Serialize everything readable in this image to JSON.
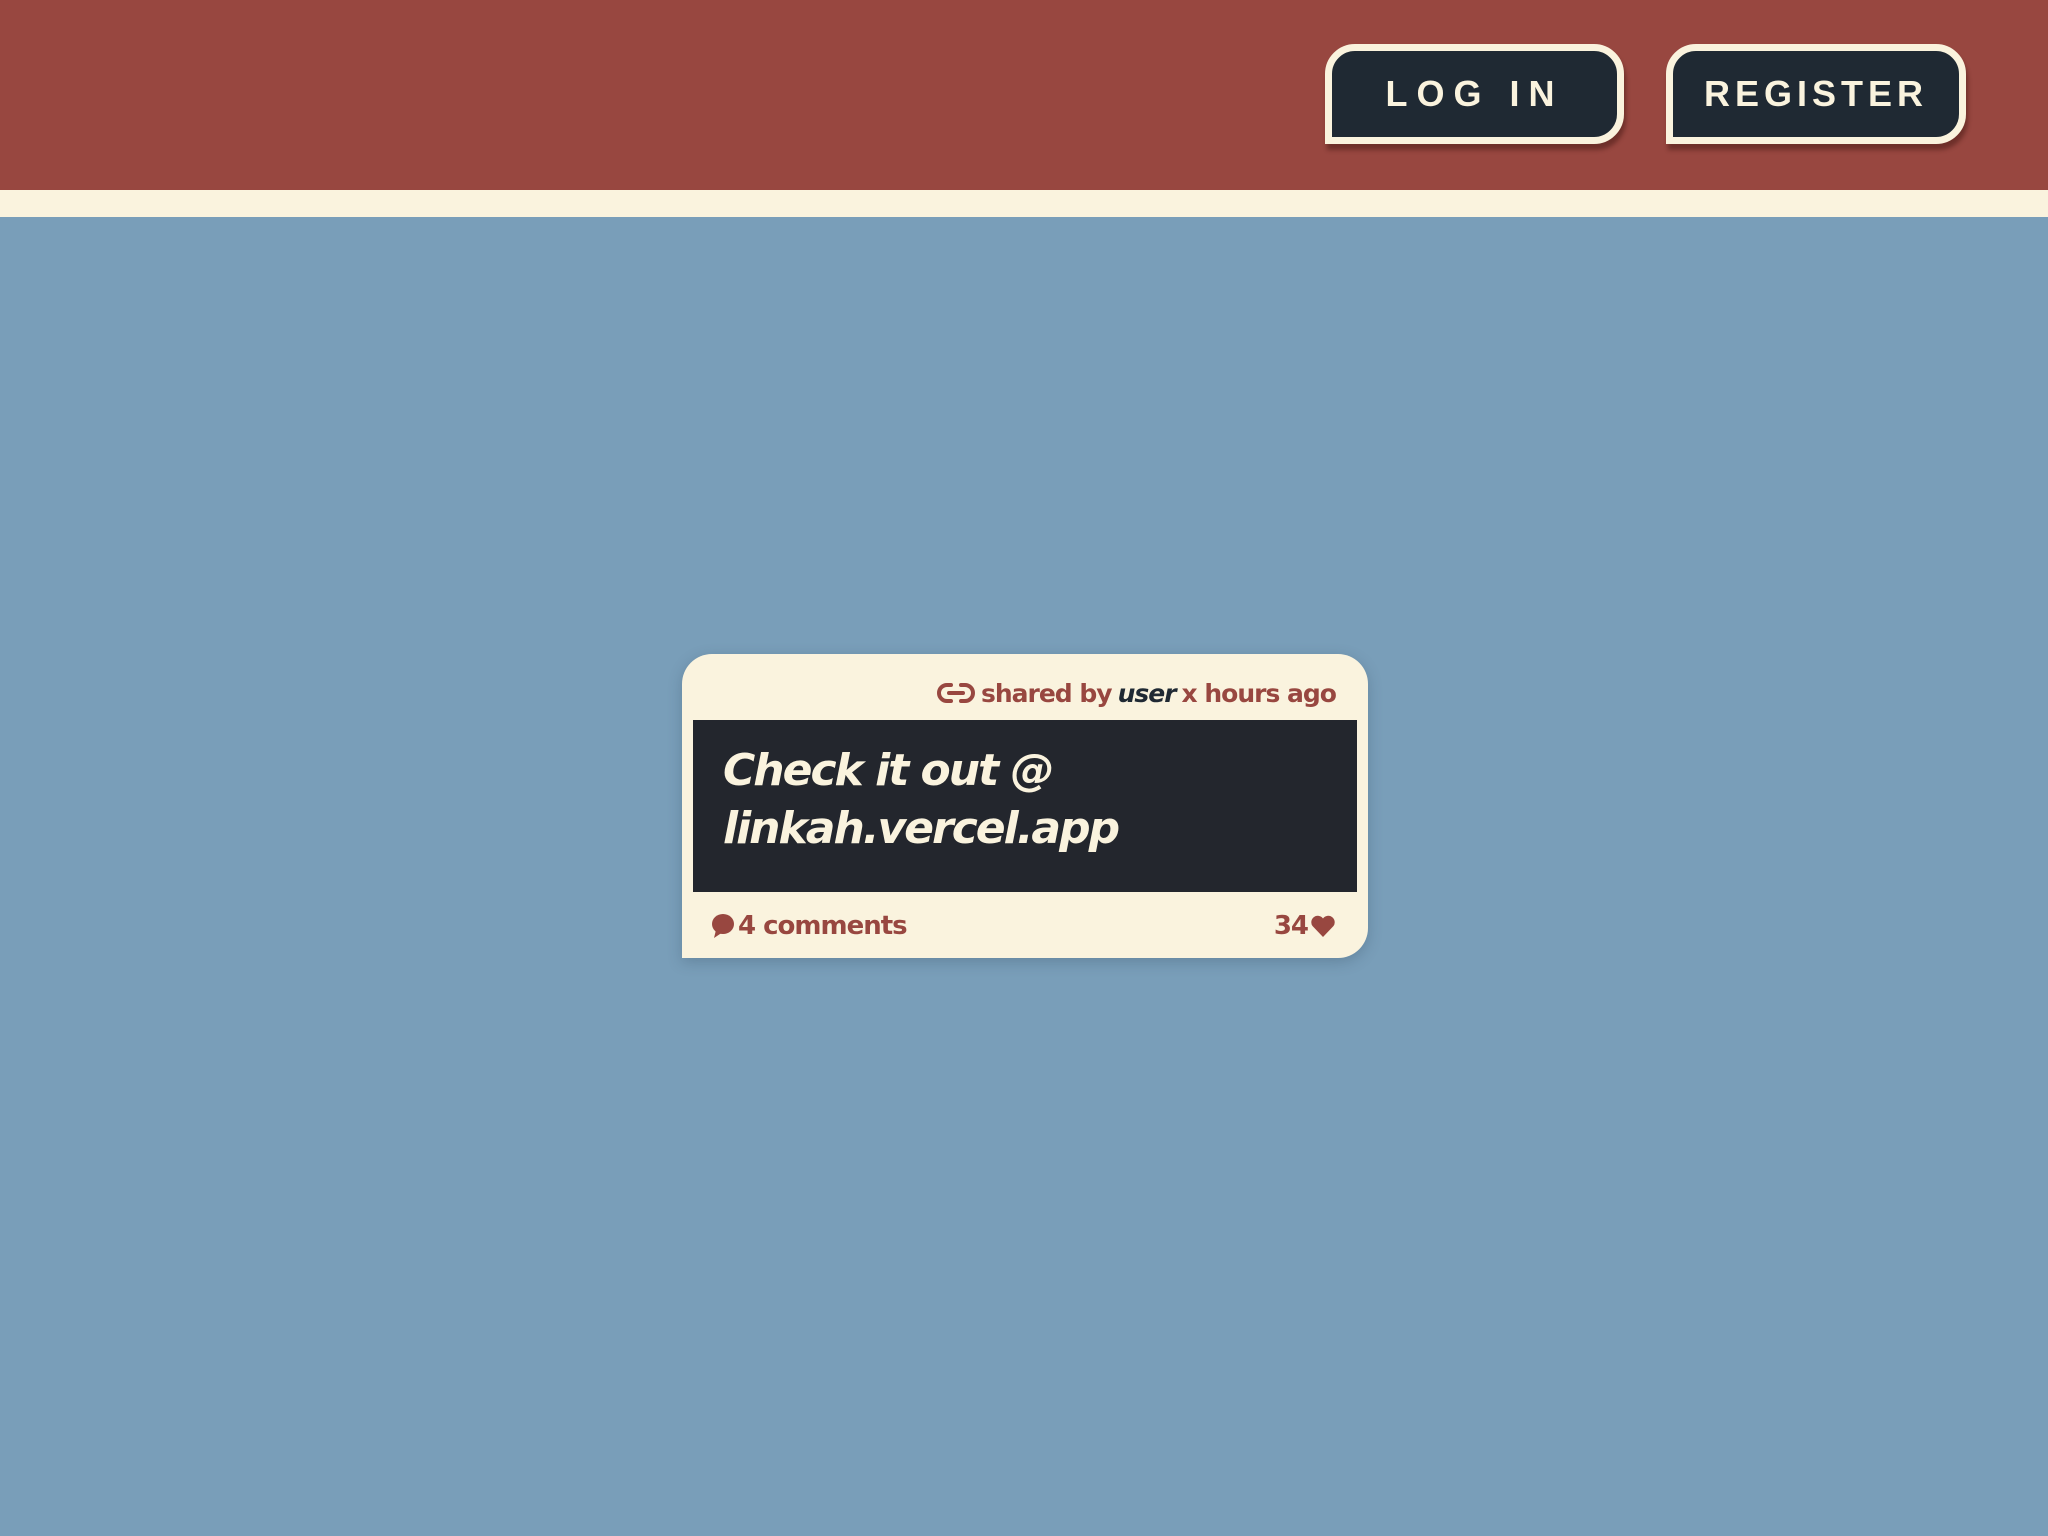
{
  "header": {
    "login_label": "LOG IN",
    "register_label": "REGISTER"
  },
  "colors": {
    "header_bg": "#984740",
    "page_bg": "#799eb9",
    "cream": "#faf3de",
    "dark": "#1f2933"
  },
  "post": {
    "meta_prefix": "shared by",
    "user": "user",
    "time": "x hours ago",
    "content": "Check it out @ linkah.vercel.app",
    "comments_label": "4 comments",
    "likes_count": "34",
    "icons": {
      "meta": "link-icon",
      "comments": "comment-bubble-icon",
      "likes": "heart-icon"
    }
  }
}
